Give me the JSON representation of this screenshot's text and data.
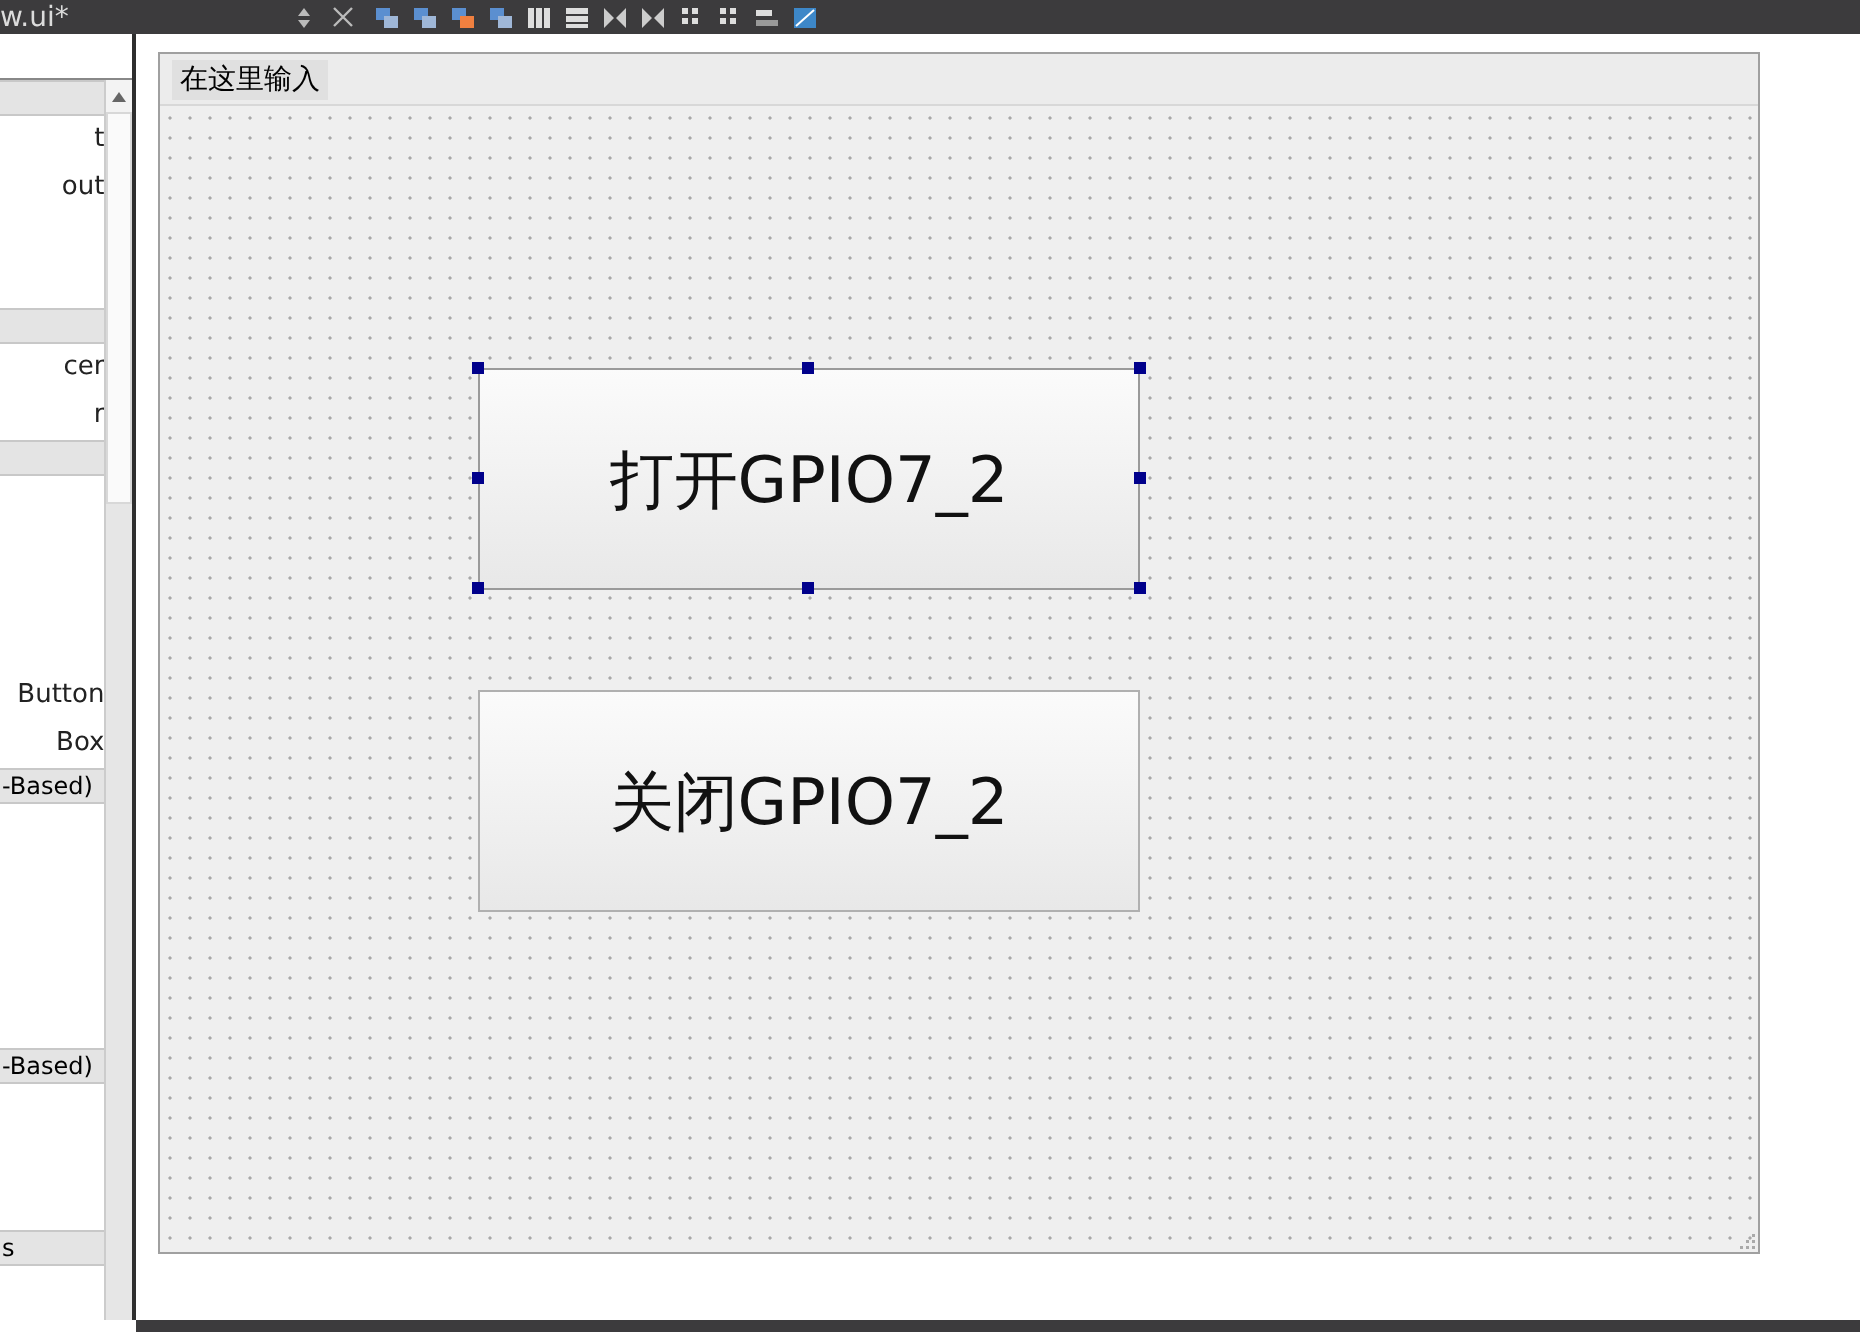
{
  "title_bar": {
    "file_name": "w.ui*"
  },
  "widget_box": {
    "sections": [
      {
        "items": [
          "t",
          "out"
        ]
      },
      {
        "items": [
          "cer",
          "r"
        ]
      },
      {
        "items": [
          "Button",
          "Box"
        ]
      },
      {
        "header": "-Based)"
      },
      {
        "header": "-Based)"
      },
      {
        "header": "s"
      }
    ]
  },
  "form": {
    "menu_bar": {
      "placeholder_item": "在这里输入"
    },
    "buttons": [
      {
        "label": "打开GPIO7_2",
        "selected": true
      },
      {
        "label": "关闭GPIO7_2",
        "selected": false
      }
    ]
  }
}
